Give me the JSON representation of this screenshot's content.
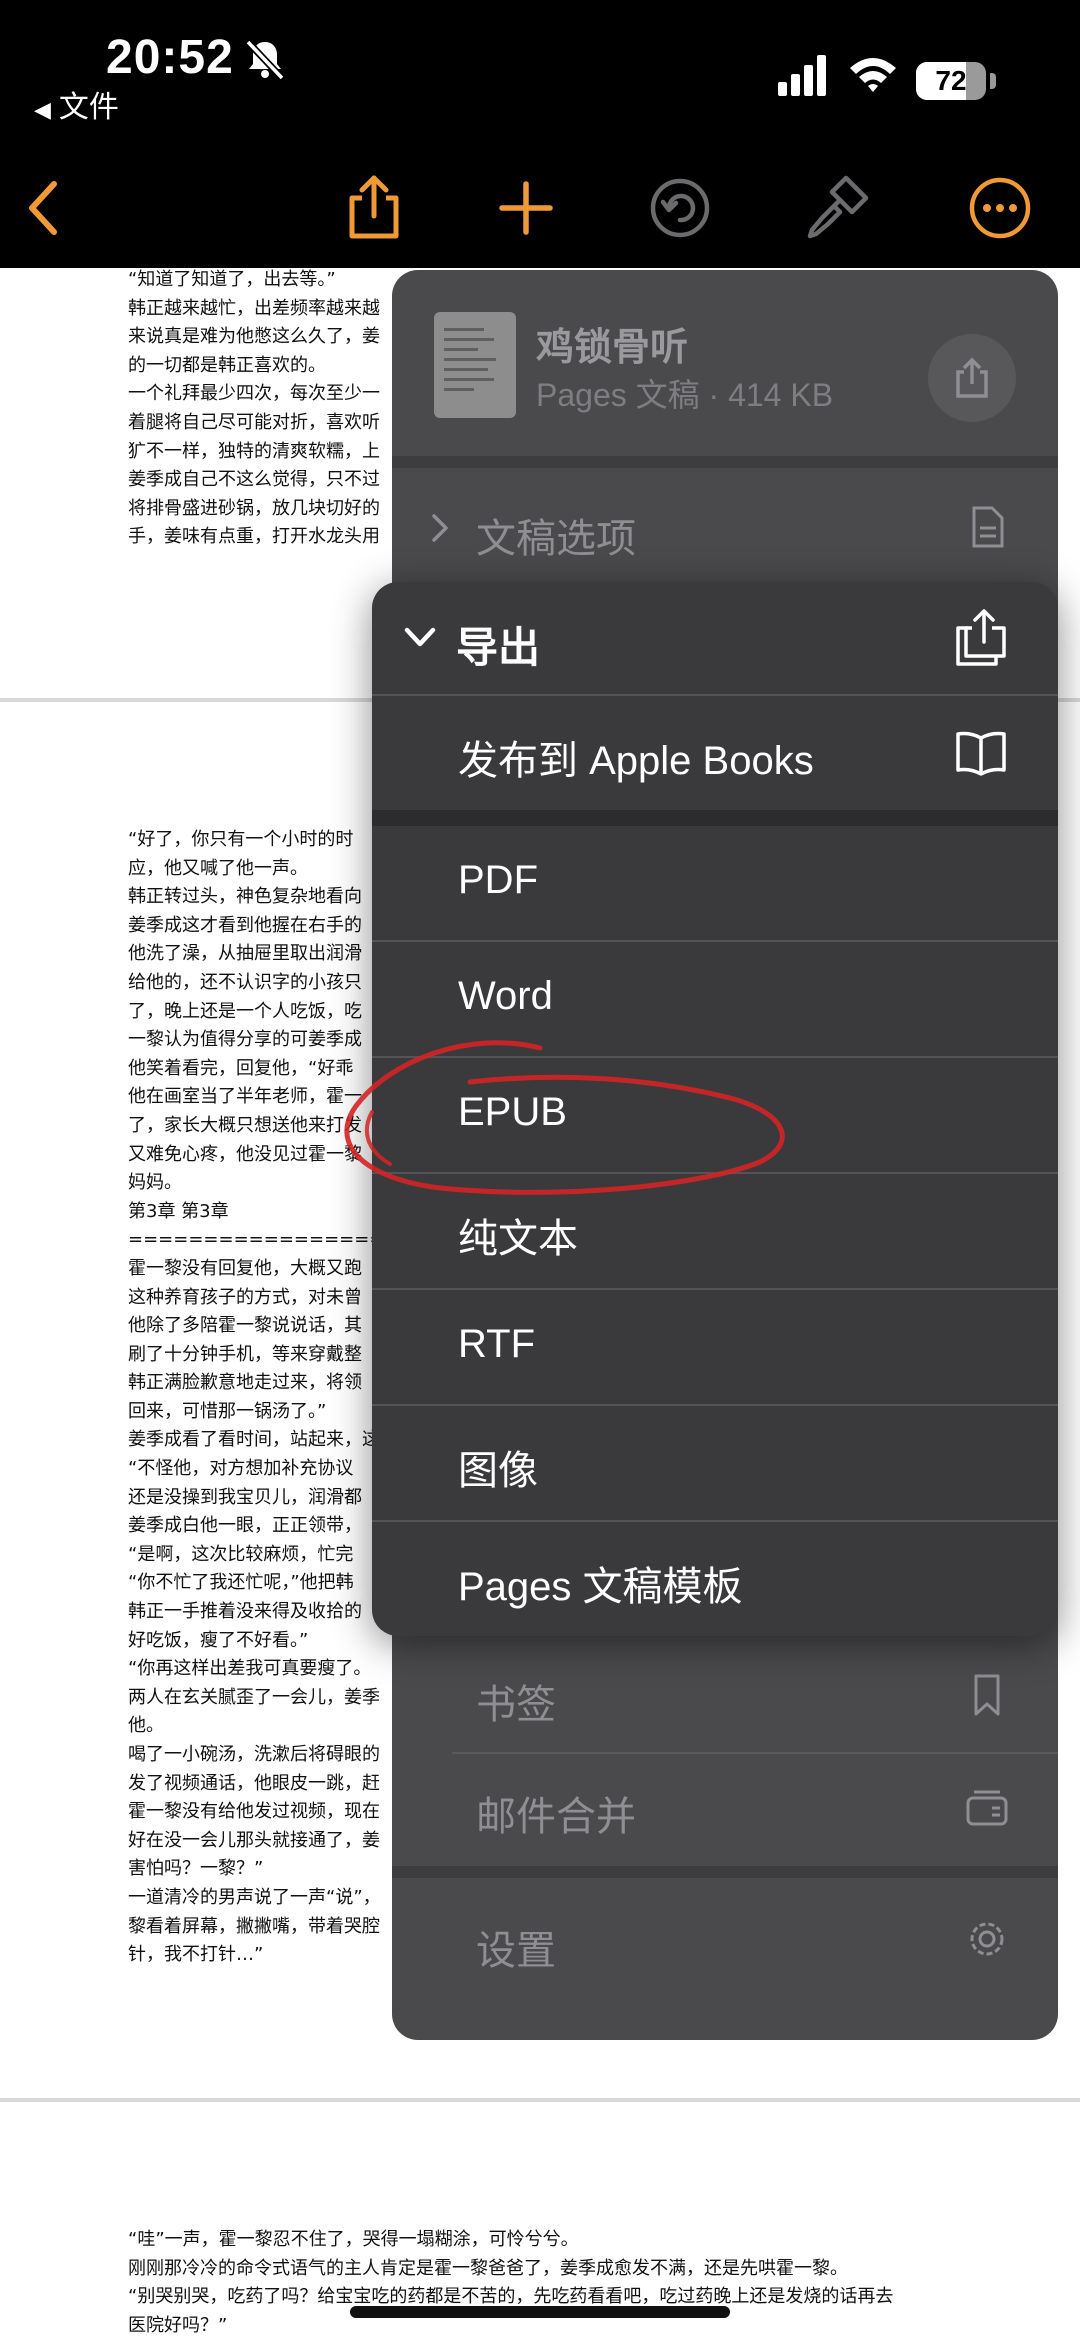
{
  "status_bar": {
    "time": "20:52",
    "back_app": "文件",
    "battery": "72",
    "battery_level": 0.72
  },
  "document": {
    "page1": [
      "“知道了知道了，出去等。”",
      "韩正越来越忙，出差频率越来越",
      "来说真是难为他憋这么久了，姜",
      "的一切都是韩正喜欢的。",
      "一个礼拜最少四次，每次至少一",
      "着腿将自己尽可能对折，喜欢听",
      "犷不一样，独特的清爽软糯，上",
      "姜季成自己不这么觉得，只不过",
      "将排骨盛进砂锅，放几块切好的",
      "手，姜味有点重，打开水龙头用"
    ],
    "page2": [
      "“好了，你只有一个小时的时",
      "应，他又喊了他一声。",
      "韩正转过头，神色复杂地看向",
      "姜季成这才看到他握在右手的",
      "他洗了澡，从抽屉里取出润滑",
      "给他的，还不认识字的小孩只",
      "了，晚上还是一个人吃饭，吃",
      "一黎认为值得分享的可姜季成",
      "他笑着看完，回复他，“好乖",
      "他在画室当了半年老师，霍一",
      "了，家长大概只想送他来打发",
      "又难免心疼，他没见过霍一黎",
      "妈妈。",
      "第3章 第3章",
      "====================",
      "霍一黎没有回复他，大概又跑",
      "这种养育孩子的方式，对未曾",
      "他除了多陪霍一黎说说话，其",
      "刷了十分钟手机，等来穿戴整",
      "韩正满脸歉意地走过来，将领",
      "回来，可惜那一锅汤了。”",
      "姜季成看了看时间，站起来，这",
      "“不怪他，对方想加补充协议",
      "还是没操到我宝贝儿，润滑都",
      "姜季成白他一眼，正正领带，",
      "“是啊，这次比较麻烦，忙完",
      "“你不忙了我还忙呢，”他把韩",
      "韩正一手推着没来得及收拾的",
      "好吃饭，瘦了不好看。”",
      "“你再这样出差我可真要瘦了。",
      "两人在玄关腻歪了一会儿，姜季",
      "他。",
      "喝了一小碗汤，洗漱后将碍眼的",
      "发了视频通话，他眼皮一跳，赶",
      "霍一黎没有给他发过视频，现在",
      "好在没一会儿那头就接通了，姜",
      "害怕吗？一黎？”",
      "一道清冷的男声说了一声“说”，",
      "黎看着屏幕，撇撇嘴，带着哭腔",
      "针，我不打针…”"
    ],
    "page3": [
      "“哇”一声，霍一黎忍不住了，哭得一塌糊涂，可怜兮兮。",
      "刚刚那冷冷的命令式语气的主人肯定是霍一黎爸爸了，姜季成愈发不满，还是先哄霍一黎。",
      "“别哭别哭，吃药了吗？给宝宝吃的药都是不苦的，先吃药看看吧，吃过药晚上还是发烧的话再去",
      "医院好吗？”"
    ]
  },
  "menu": {
    "file_name": "鸡锁骨听",
    "file_info": "Pages 文稿 · 414 KB",
    "document_options": "文稿选项",
    "bookmarks": "书签",
    "mail_merge": "邮件合并",
    "settings": "设置"
  },
  "export_menu": {
    "title": "导出",
    "publish": "发布到 Apple Books",
    "options": [
      "PDF",
      "Word",
      "EPUB",
      "纯文本",
      "RTF",
      "图像",
      "Pages 文稿模板"
    ]
  },
  "colors": {
    "accent": "#f09a37",
    "toolbar_bg": "#000000",
    "menu_bg": "#3a3a3c",
    "annotation": "#d42525"
  }
}
